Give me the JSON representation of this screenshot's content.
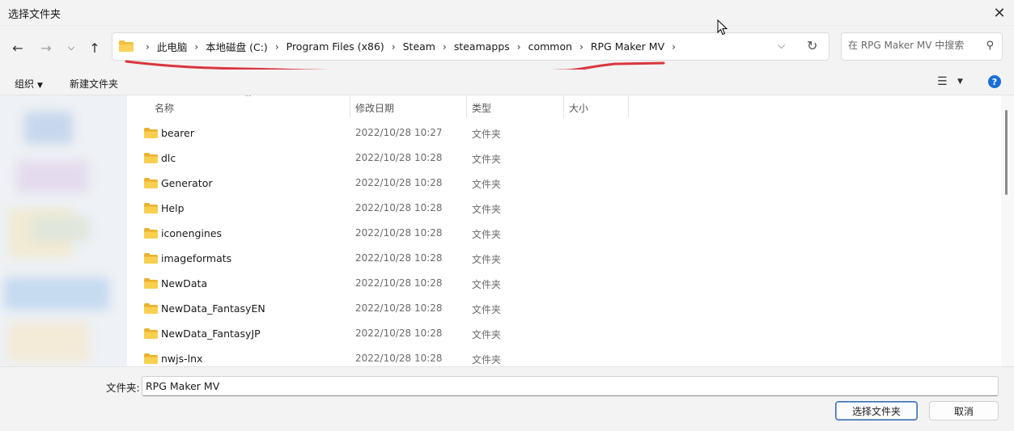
{
  "window": {
    "title": "选择文件夹",
    "close_icon": "close-icon"
  },
  "navigation": {
    "back_icon": "arrow-left-icon",
    "forward_icon": "arrow-right-icon",
    "recent_icon": "chevron-down-icon",
    "up_icon": "arrow-up-icon"
  },
  "address": {
    "crumbs": [
      "此电脑",
      "本地磁盘 (C:)",
      "Program Files (x86)",
      "Steam",
      "steamapps",
      "common",
      "RPG Maker MV"
    ],
    "annotation_color": "#d9363e"
  },
  "search": {
    "placeholder": "在 RPG Maker MV 中搜索"
  },
  "toolbar": {
    "organize_label": "组织",
    "new_folder_label": "新建文件夹"
  },
  "columns": {
    "name": "名称",
    "modified": "修改日期",
    "type": "类型",
    "size": "大小"
  },
  "files": [
    {
      "name": "bearer",
      "modified": "2022/10/28 10:27",
      "type": "文件夹"
    },
    {
      "name": "dlc",
      "modified": "2022/10/28 10:28",
      "type": "文件夹"
    },
    {
      "name": "Generator",
      "modified": "2022/10/28 10:28",
      "type": "文件夹"
    },
    {
      "name": "Help",
      "modified": "2022/10/28 10:28",
      "type": "文件夹"
    },
    {
      "name": "iconengines",
      "modified": "2022/10/28 10:28",
      "type": "文件夹"
    },
    {
      "name": "imageformats",
      "modified": "2022/10/28 10:28",
      "type": "文件夹"
    },
    {
      "name": "NewData",
      "modified": "2022/10/28 10:28",
      "type": "文件夹"
    },
    {
      "name": "NewData_FantasyEN",
      "modified": "2022/10/28 10:28",
      "type": "文件夹"
    },
    {
      "name": "NewData_FantasyJP",
      "modified": "2022/10/28 10:28",
      "type": "文件夹"
    },
    {
      "name": "nwjs-lnx",
      "modified": "2022/10/28 10:28",
      "type": "文件夹"
    }
  ],
  "footer": {
    "folder_label": "文件夹:",
    "folder_value": "RPG Maker MV",
    "select_button": "选择文件夹",
    "cancel_button": "取消"
  },
  "colors": {
    "folder": "#f0c040",
    "accent": "#1a6fd6"
  }
}
